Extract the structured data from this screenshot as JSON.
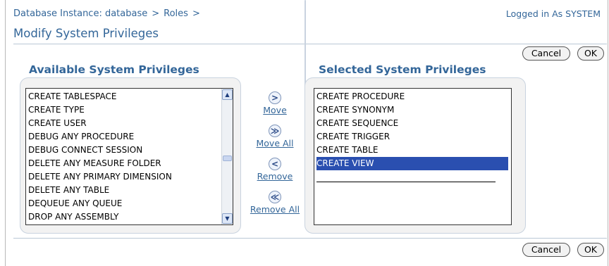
{
  "header": {
    "breadcrumb": [
      "Database Instance: database",
      "Roles"
    ],
    "breadcrumb_separator": ">",
    "logged_in": "Logged in As SYSTEM",
    "title": "Modify System Privileges"
  },
  "buttons": {
    "cancel": "Cancel",
    "ok": "OK"
  },
  "available": {
    "heading": "Available System Privileges",
    "items": [
      "CREATE TABLESPACE",
      "CREATE TYPE",
      "CREATE USER",
      "DEBUG ANY PROCEDURE",
      "DEBUG CONNECT SESSION",
      "DELETE ANY MEASURE FOLDER",
      "DELETE ANY PRIMARY DIMENSION",
      "DELETE ANY TABLE",
      "DEQUEUE ANY QUEUE",
      "DROP ANY ASSEMBLY"
    ]
  },
  "selected": {
    "heading": "Selected System Privileges",
    "items": [
      "CREATE PROCEDURE",
      "CREATE SYNONYM",
      "CREATE SEQUENCE",
      "CREATE TRIGGER",
      "CREATE TABLE",
      "CREATE VIEW"
    ],
    "highlighted_item": "CREATE VIEW"
  },
  "shuttle": {
    "move": {
      "label": "Move",
      "icon": "move-right-icon",
      "glyph": ">"
    },
    "move_all": {
      "label": "Move All",
      "icon": "move-all-right-icon",
      "glyph": "≫"
    },
    "remove": {
      "label": "Remove",
      "icon": "move-left-icon",
      "glyph": "<"
    },
    "remove_all": {
      "label": "Remove All",
      "icon": "move-all-left-icon",
      "glyph": "≪"
    }
  },
  "colors": {
    "link": "#336699",
    "selection": "#2a4fb0",
    "panel_background": "#f2f2f2"
  }
}
